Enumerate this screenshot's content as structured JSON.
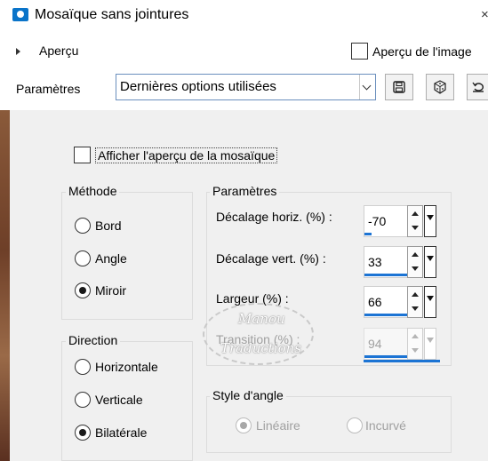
{
  "window": {
    "title": "Mosaïque sans jointures",
    "close": "×"
  },
  "preview": {
    "label": "Aperçu",
    "image_label": "Aperçu de l'image"
  },
  "presets": {
    "label": "Paramètres",
    "value": "Dernières options utilisées"
  },
  "options": {
    "show_preview_label": "Afficher l'aperçu de la mosaïque"
  },
  "method": {
    "title": "Méthode",
    "items": [
      {
        "label": "Bord",
        "selected": false
      },
      {
        "label": "Angle",
        "selected": false
      },
      {
        "label": "Miroir",
        "selected": true
      }
    ]
  },
  "params": {
    "title": "Paramètres",
    "items": [
      {
        "label": "Décalage horiz. (%) :",
        "value": "-70",
        "fill": 0.15
      },
      {
        "label": "Décalage vert. (%) :",
        "value": "33",
        "fill": 0.67
      },
      {
        "label": "Largeur (%) :",
        "value": "66",
        "fill": 0.83
      },
      {
        "label": "Transition (%) :",
        "value": "94",
        "fill": 0.97,
        "disabled": true
      }
    ]
  },
  "direction": {
    "title": "Direction",
    "items": [
      {
        "label": "Horizontale",
        "selected": false
      },
      {
        "label": "Verticale",
        "selected": false
      },
      {
        "label": "Bilatérale",
        "selected": true
      }
    ]
  },
  "corner_style": {
    "title": "Style d'angle",
    "items": [
      {
        "label": "Linéaire",
        "selected": true,
        "disabled": true
      },
      {
        "label": "Incurvé",
        "selected": false,
        "disabled": true
      }
    ]
  },
  "watermark": {
    "line1": "Manou",
    "line2": "Traductions"
  },
  "colors": {
    "accent": "#1c74d4",
    "panel": "#f0f0f0",
    "icon": "#0a74c9"
  }
}
